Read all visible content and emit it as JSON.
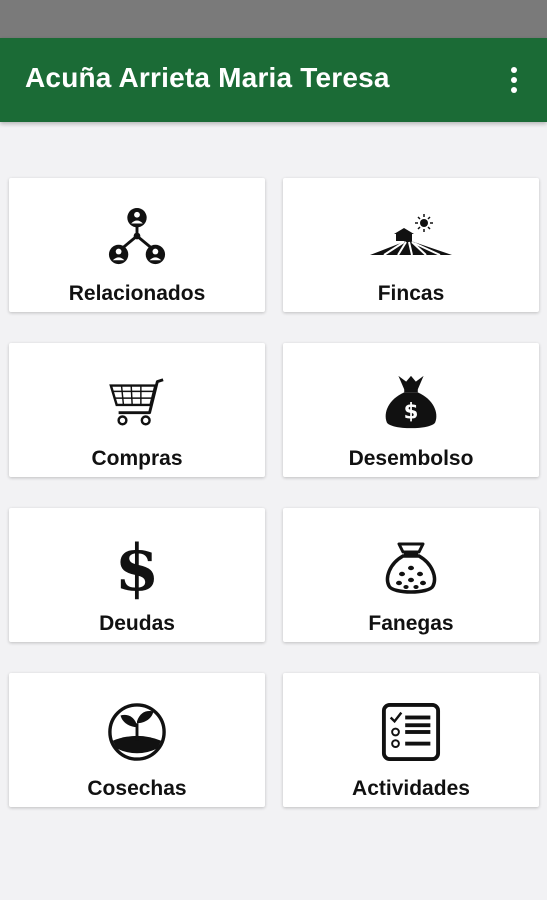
{
  "appbar": {
    "title": "Acuña Arrieta Maria Teresa",
    "menu_icon": "more-vert-icon"
  },
  "colors": {
    "primary": "#1b6b36",
    "statusbar": "#7a7a7a",
    "background": "#f2f2f4",
    "card": "#ffffff"
  },
  "menu": {
    "items": [
      {
        "label": "Relacionados",
        "icon": "people-network-icon"
      },
      {
        "label": "Fincas",
        "icon": "farm-field-icon"
      },
      {
        "label": "Compras",
        "icon": "shopping-cart-icon"
      },
      {
        "label": "Desembolso",
        "icon": "money-bag-icon"
      },
      {
        "label": "Deudas",
        "icon": "dollar-sign-icon"
      },
      {
        "label": "Fanegas",
        "icon": "grain-sack-icon"
      },
      {
        "label": "Cosechas",
        "icon": "sprout-icon"
      },
      {
        "label": "Actividades",
        "icon": "checklist-icon"
      }
    ]
  }
}
